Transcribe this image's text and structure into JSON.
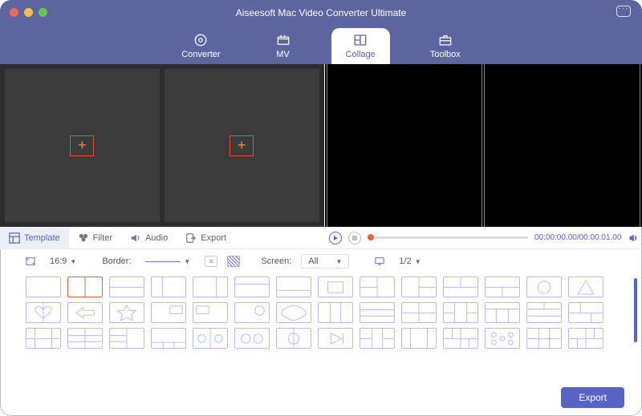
{
  "window_title": "Aiseesoft Mac Video Converter Ultimate",
  "nav": {
    "converter": "Converter",
    "mv": "MV",
    "collage": "Collage",
    "toolbox": "Toolbox"
  },
  "subtabs": {
    "template": "Template",
    "filter": "Filter",
    "audio": "Audio",
    "export": "Export"
  },
  "playback": {
    "time": "00:00:00.00/00:00:01.00"
  },
  "options": {
    "ratio": "16:9",
    "border_label": "Border:",
    "screen_label": "Screen:",
    "screen_value": "All",
    "page": "1/2"
  },
  "export_button": "Export"
}
